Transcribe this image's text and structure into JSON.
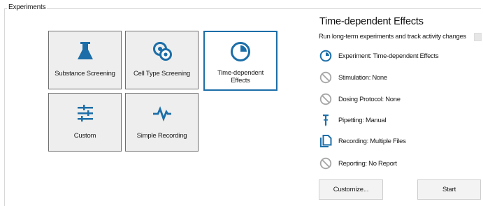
{
  "group": {
    "title": "Experiments"
  },
  "tiles": [
    {
      "label": "Substance Screening",
      "icon": "flask-icon",
      "selected": false
    },
    {
      "label": "Cell Type Screening",
      "icon": "cells-icon",
      "selected": false
    },
    {
      "label": "Time-dependent Effects",
      "icon": "clock-pie-icon",
      "selected": true
    },
    {
      "label": "Custom",
      "icon": "sliders-icon",
      "selected": false
    },
    {
      "label": "Simple Recording",
      "icon": "pulse-icon",
      "selected": false
    }
  ],
  "panel": {
    "title": "Time-dependent Effects",
    "subtitle": "Run long-term experiments and track activity changes",
    "checkbox_checked": false,
    "details": [
      {
        "label": "Experiment: Time-dependent Effects",
        "icon": "clock-pie-icon",
        "active": true
      },
      {
        "label": "Stimulation: None",
        "icon": "disabled-icon",
        "active": false
      },
      {
        "label": "Dosing Protocol: None",
        "icon": "disabled-icon",
        "active": false
      },
      {
        "label": "Pipetting: Manual",
        "icon": "pipette-icon",
        "active": true
      },
      {
        "label": "Recording: Multiple Files",
        "icon": "files-icon",
        "active": true
      },
      {
        "label": "Reporting: No Report",
        "icon": "disabled-icon",
        "active": false
      }
    ]
  },
  "buttons": {
    "customize": "Customize...",
    "start": "Start"
  },
  "colors": {
    "accent": "#1c6ea8",
    "disabled": "#a6a6a6",
    "tile_bg": "#eeeeee"
  }
}
